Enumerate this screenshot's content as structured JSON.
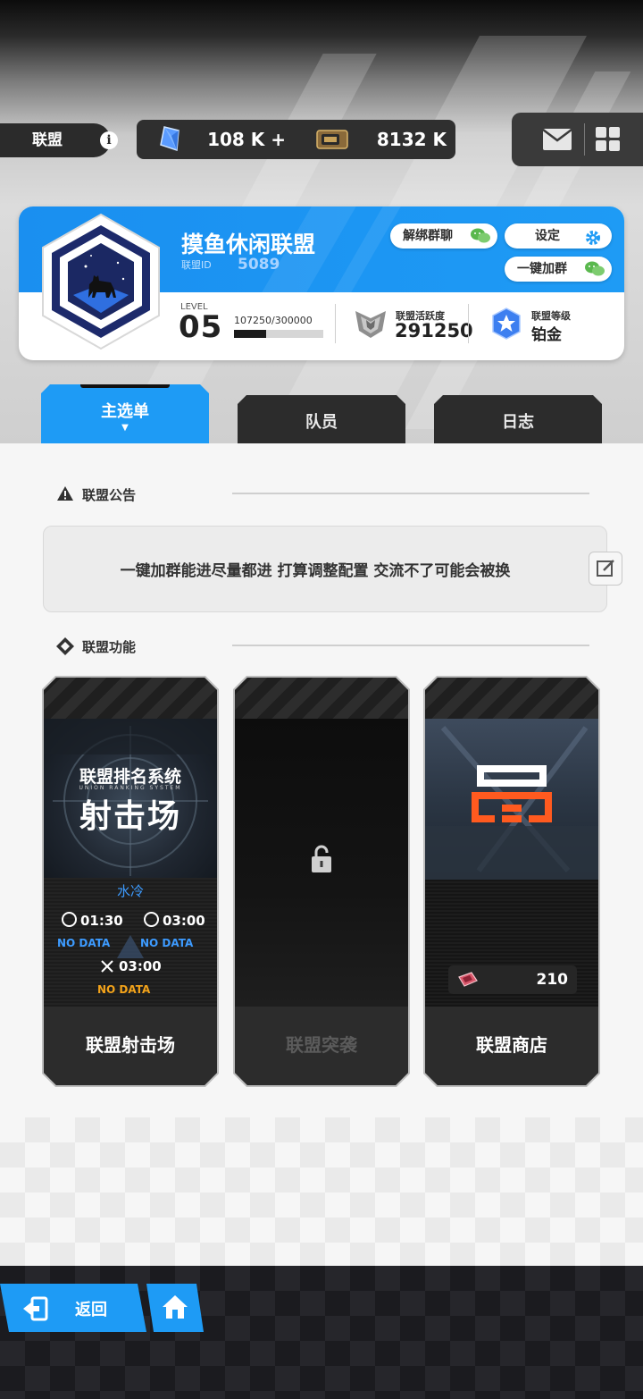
{
  "header": {
    "section_label": "联盟",
    "currency": {
      "gems": "108 K +",
      "tickets": "8132 K"
    },
    "icons": [
      "info-icon",
      "gem-icon",
      "ticket-icon",
      "mail-icon",
      "grid-menu-icon"
    ]
  },
  "alliance": {
    "name": "摸鱼休闲联盟",
    "id_label": "联盟ID",
    "id_value": "5089",
    "level_label": "LEVEL",
    "level": "05",
    "exp_text": "107250/300000",
    "exp_progress": 0.3575,
    "activity_label": "联盟活跃度",
    "activity_value": "291250",
    "rank_label": "联盟等级",
    "rank_value": "铂金",
    "buttons": {
      "unbind_group_chat": "解绑群聊",
      "settings": "设定",
      "one_click_join_group": "一键加群"
    }
  },
  "tabs": [
    {
      "label": "主选单",
      "active": true,
      "indicator": "▼"
    },
    {
      "label": "队员",
      "active": false
    },
    {
      "label": "日志",
      "active": false
    }
  ],
  "announcement": {
    "title": "联盟公告",
    "text": "一键加群能进尽量都进 打算调整配置 交流不了可能会被换"
  },
  "features": {
    "title": "联盟功能",
    "shooting_range": {
      "label": "联盟射击场",
      "banner_line1": "联盟排名系统",
      "banner_sub": "UNION RANKING SYSTEM",
      "banner_line2": "射击场",
      "element": "水冷",
      "timer1": "01:30",
      "timer2": "03:00",
      "timer3": "03:00",
      "nodata1": "NO DATA",
      "nodata2": "NO DATA",
      "nodata3": "NO DATA"
    },
    "raid": {
      "label": "联盟突袭",
      "locked": true
    },
    "shop": {
      "label": "联盟商店",
      "currency_value": "210"
    }
  },
  "navigation": {
    "back_label": "返回"
  },
  "colors": {
    "accent_blue": "#1e9bf5",
    "dark_panel": "#2c2c2c",
    "no_data_blue": "#3d9bff",
    "no_data_orange": "#f3a31a",
    "shop_logo_orange": "#ff5a1f"
  }
}
